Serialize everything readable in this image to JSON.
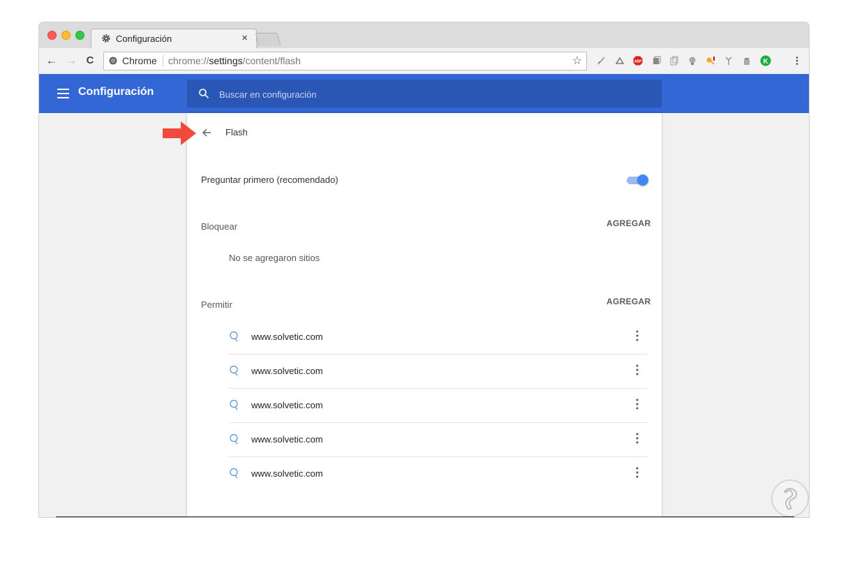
{
  "window": {
    "tab_title": "Configuración",
    "tab_close": "×"
  },
  "toolbar": {
    "origin": "Chrome",
    "url_scheme": "chrome://",
    "url_host": "settings",
    "url_path": "/content/flash",
    "back": "←",
    "forward": "→",
    "reload": "C",
    "star": "☆"
  },
  "appbar": {
    "title": "Configuración",
    "search_placeholder": "Buscar en configuración",
    "color": "#3367d6"
  },
  "page": {
    "title": "Flash",
    "ask_first_label": "Preguntar primero (recomendado)",
    "ask_first_enabled": true,
    "block": {
      "title": "Bloquear",
      "add_label": "AGREGAR",
      "empty_text": "No se agregaron sitios"
    },
    "allow": {
      "title": "Permitir",
      "add_label": "AGREGAR",
      "sites": [
        "www.solvetic.com",
        "www.solvetic.com",
        "www.solvetic.com",
        "www.solvetic.com",
        "www.solvetic.com"
      ]
    }
  },
  "colors": {
    "toggle_on": "#4285f4",
    "annotation_arrow": "#ef4a3c"
  }
}
